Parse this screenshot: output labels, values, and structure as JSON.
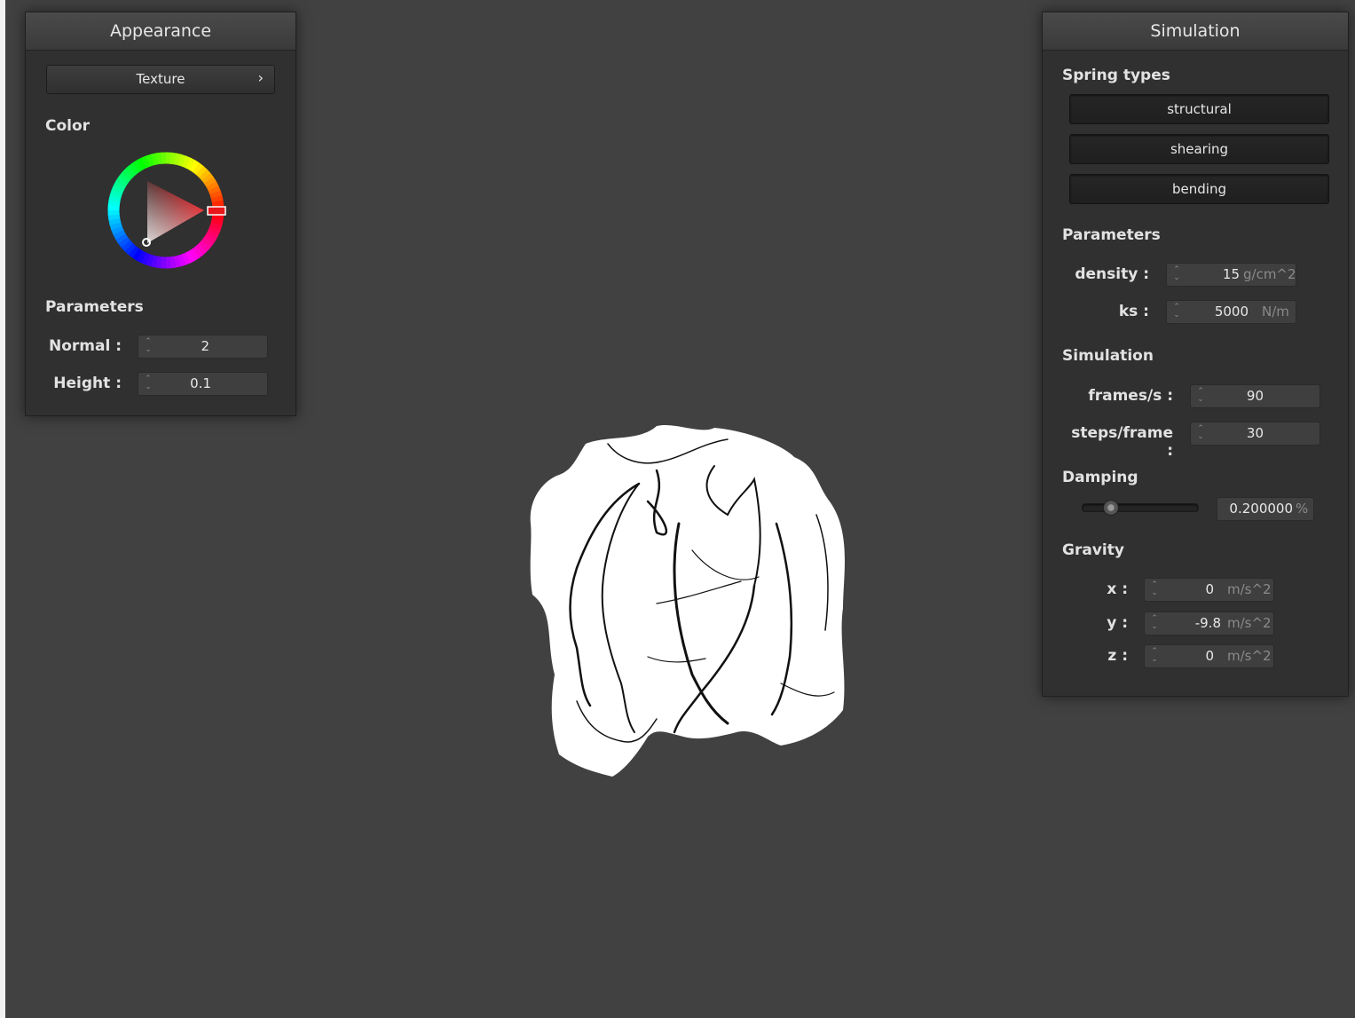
{
  "appearance": {
    "title": "Appearance",
    "texture_button": "Texture",
    "texture_chevron": "›",
    "color_label": "Color",
    "selected_color": "#e8171c",
    "parameters_label": "Parameters",
    "normal": {
      "label": "Normal :",
      "value": "2"
    },
    "height": {
      "label": "Height :",
      "value": "0.1"
    }
  },
  "simulation": {
    "title": "Simulation",
    "spring_types_label": "Spring types",
    "spring_types": [
      "structural",
      "shearing",
      "bending"
    ],
    "parameters_label": "Parameters",
    "density": {
      "label": "density :",
      "value": "15",
      "unit": "g/cm^2"
    },
    "ks": {
      "label": "ks :",
      "value": "5000",
      "unit": "N/m"
    },
    "simulation_label": "Simulation",
    "fps": {
      "label": "frames/s :",
      "value": "90"
    },
    "steps": {
      "label": "steps/frame :",
      "value": "30"
    },
    "damping_label": "Damping",
    "damping": {
      "value": "0.200000",
      "unit": "%",
      "slider_fraction": 0.2
    },
    "gravity_label": "Gravity",
    "gravity": [
      {
        "label": "x :",
        "value": "0",
        "unit": "m/s^2"
      },
      {
        "label": "y :",
        "value": "-9.8",
        "unit": "m/s^2"
      },
      {
        "label": "z :",
        "value": "0",
        "unit": "m/s^2"
      }
    ]
  },
  "icons": {
    "spin_arrows": "⌃⌄",
    "cloth": "cloth-render"
  },
  "colors": {
    "background": "#414141",
    "panel": "#303030",
    "accent": "#e8171c"
  }
}
